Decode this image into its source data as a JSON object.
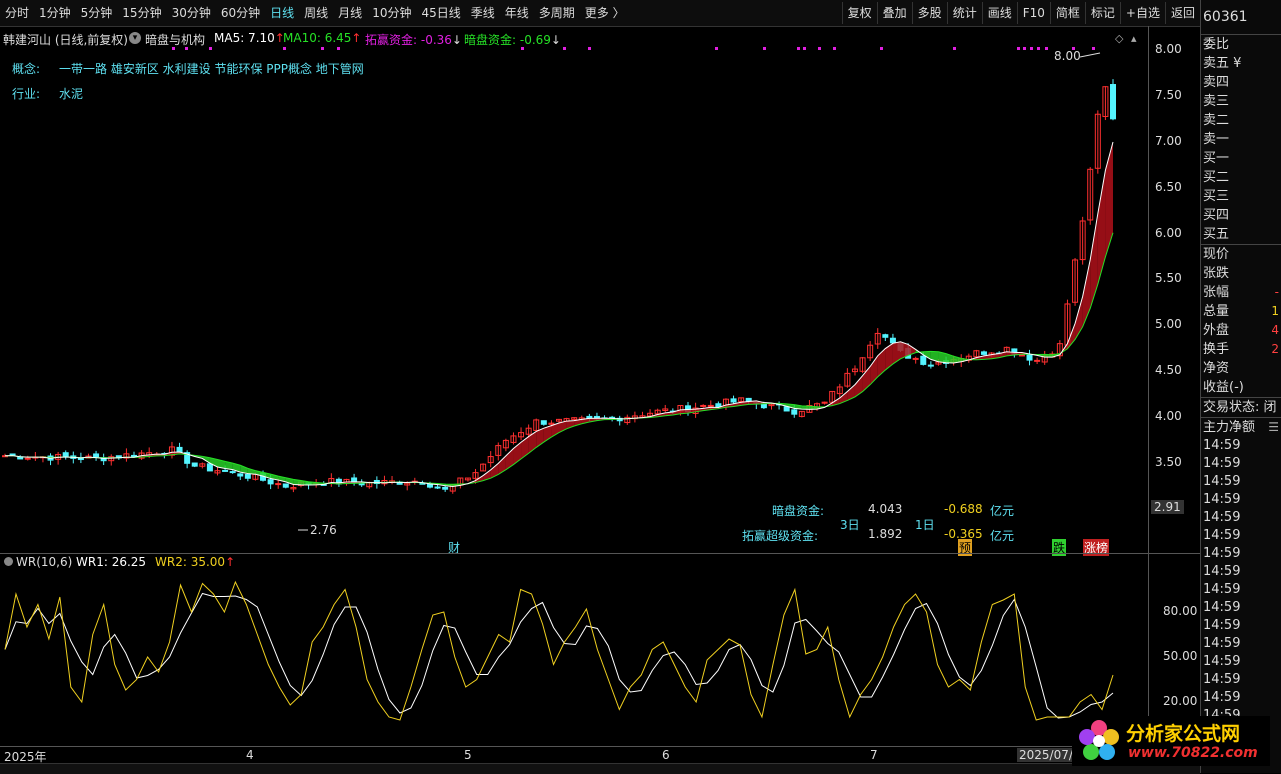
{
  "toolbar": {
    "periods": [
      "分时",
      "1分钟",
      "5分钟",
      "15分钟",
      "30分钟",
      "60分钟",
      "日线",
      "周线",
      "月线",
      "10分钟",
      "45日线",
      "季线",
      "年线",
      "多周期",
      "更多 〉"
    ],
    "active": "日线",
    "right": [
      "复权",
      "叠加",
      "多股",
      "统计",
      "画线",
      "F10",
      "简框",
      "标记",
      "+自选",
      "返回"
    ]
  },
  "stock": {
    "title": "韩建河山 (日线,前复权)",
    "indicator": "暗盘与机构",
    "code": "60361"
  },
  "legend": {
    "ma5": "MA5: 7.10",
    "ma10": "MA10: 6.45",
    "tuoying": "拓赢资金: -0.36",
    "anpan": "暗盘资金: -0.69",
    "arrow_up": "↑",
    "arrow_down": "↓"
  },
  "info": {
    "concept_label": "概念:",
    "concept_value": "一带一路 雄安新区 水利建设 节能环保 PPP概念 地下管网",
    "industry_label": "行业:",
    "industry_value": "水泥"
  },
  "price_axis": {
    "ticks": [
      "8.00",
      "7.50",
      "7.00",
      "6.50",
      "6.00",
      "5.50",
      "5.00",
      "4.50",
      "4.00",
      "3.50"
    ],
    "current": "2.91"
  },
  "annotations": {
    "high": "8.00",
    "low": "2.76"
  },
  "flow": {
    "anpan_label": "暗盘资金:",
    "anpan_3d": "4.043",
    "anpan_1d": "-0.688",
    "unit": "亿元",
    "days3": "3日",
    "days1": "1日",
    "tuoying_label": "拓赢超级资金:",
    "tuoying_3d": "1.892",
    "tuoying_1d": "-0.365"
  },
  "markers": {
    "cai": "财",
    "yu": "预",
    "die": "跌",
    "zhang": "涨榜"
  },
  "wr": {
    "title": "WR(10,6)",
    "wr1": "WR1: 26.25",
    "wr2": "WR2: 35.00",
    "arrow": "↑",
    "ticks": [
      "80.00",
      "50.00",
      "20.00"
    ]
  },
  "time_axis": {
    "labels": [
      "2025年",
      "4",
      "5",
      "6",
      "7",
      "2025/07/"
    ]
  },
  "right_panel": {
    "order_book": [
      "委比",
      "卖五 ¥",
      "卖四",
      "卖三",
      "卖二",
      "卖一",
      "买一",
      "买二",
      "买三",
      "买四",
      "买五"
    ],
    "stats": [
      {
        "k": "现价",
        "v": ""
      },
      {
        "k": "张跌",
        "v": ""
      },
      {
        "k": "张幅",
        "v": "-"
      },
      {
        "k": "总量",
        "v": "1"
      },
      {
        "k": "外盘",
        "v": "4"
      },
      {
        "k": "换手",
        "v": "2"
      },
      {
        "k": "净资",
        "v": ""
      },
      {
        "k": "收益(-)",
        "v": ""
      }
    ],
    "trade_state": "交易状态: 闭",
    "main_flow": "主力净额",
    "times": [
      "14:59",
      "14:59",
      "14:59",
      "14:59",
      "14:59",
      "14:59",
      "14:59",
      "14:59",
      "14:59",
      "14:59",
      "14:59",
      "14:59",
      "14:59",
      "14:59",
      "14:59",
      "14:59",
      "14:59",
      "14:59"
    ]
  },
  "watermark": {
    "name": "分析家公式网",
    "url": "www.70822.com"
  },
  "colors": {
    "up": "#ff3030",
    "down": "#54f4ff",
    "ma5": "#ffffff",
    "ma10": "#26e026",
    "ribbon_up": "#b0101a",
    "ribbon_down": "#28d028",
    "wr1": "#ffffff",
    "wr2": "#f0d020",
    "purple": "#e020e0"
  }
}
